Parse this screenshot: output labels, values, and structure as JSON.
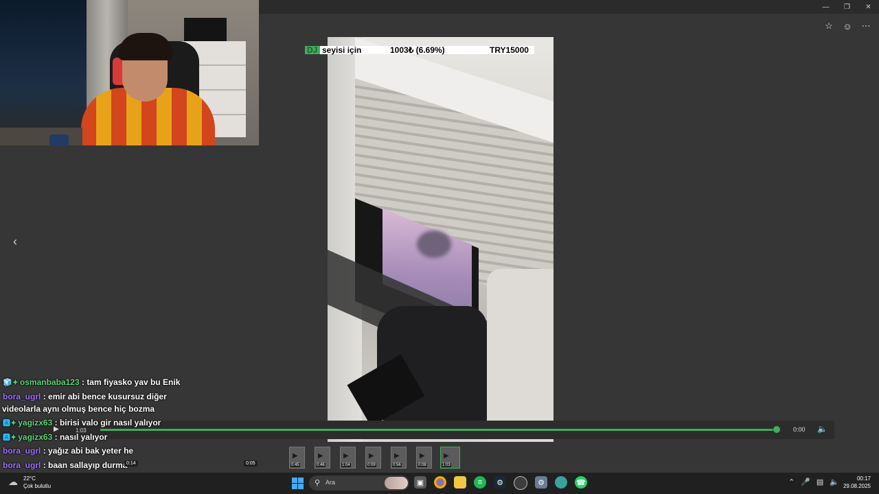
{
  "window": {
    "minimize_icon": "minimize-icon",
    "maximize_icon": "restore-icon",
    "close_icon": "close-icon"
  },
  "viewer_actions": {
    "favorite_icon": "star-icon",
    "emoji_icon": "emoji-icon",
    "more_icon": "more-icon"
  },
  "donation_goal": {
    "badge": "DJ",
    "label": "seyisi için",
    "amount": "1003₺ (6.69%)",
    "target": "TRY15000",
    "progress": 0.0669,
    "color": "#3fae5a"
  },
  "chat": [
    {
      "badges": [
        "🧊",
        "✦"
      ],
      "user": "osmanbaba123",
      "color": "green",
      "text": ": tam fiyasko yav bu Enik"
    },
    {
      "badges": [],
      "user": "bora_ugrl",
      "color": "purple",
      "text": ": emir abi bence kusursuz diğer"
    },
    {
      "continuation": "videolarla aynı olmuş bence hiç bozma"
    },
    {
      "badges": [
        "🅰",
        "✦"
      ],
      "user": "yagizx63",
      "color": "green",
      "text": ": birisi valo gir nasıl yalıyor"
    },
    {
      "badges": [
        "🅰",
        "✦"
      ],
      "user": "yagizx63",
      "color": "green",
      "text": ": nasıl yalıyor"
    },
    {
      "badges": [],
      "user": "bora_ugrl",
      "color": "purple",
      "text": ": yağız abi bak yeter he"
    },
    {
      "badges": [],
      "user": "bora_ugrl",
      "color": "purple",
      "text": ": baan sallayıp durma"
    }
  ],
  "player": {
    "play_icon": "play-icon",
    "mini_time": "1:03",
    "position": 0,
    "current_time": "0:00",
    "volume_icon": "volume-icon",
    "progress": 0.995
  },
  "timeline_labels": [
    "0:14",
    "0:05"
  ],
  "thumbnails": [
    {
      "time": "0:45"
    },
    {
      "time": "0:46"
    },
    {
      "time": "1:04"
    },
    {
      "time": "0:09"
    },
    {
      "time": "0:56"
    },
    {
      "time": "0:08"
    },
    {
      "time": "1:03",
      "active": true
    }
  ],
  "taskbar": {
    "temperature": "22°C",
    "condition": "Çok bulutlu",
    "search_placeholder": "Ara",
    "apps": [
      "task-view-icon",
      "chrome-icon",
      "file-explorer-icon",
      "spotify-icon",
      "steam-icon",
      "app-icon",
      "settings-icon",
      "browser-icon",
      "whatsapp-icon"
    ],
    "time": "00:17",
    "date": "29.08.2025"
  },
  "colors": {
    "accent": "#3fae5a",
    "background": "#363636",
    "taskbar": "#202020"
  }
}
